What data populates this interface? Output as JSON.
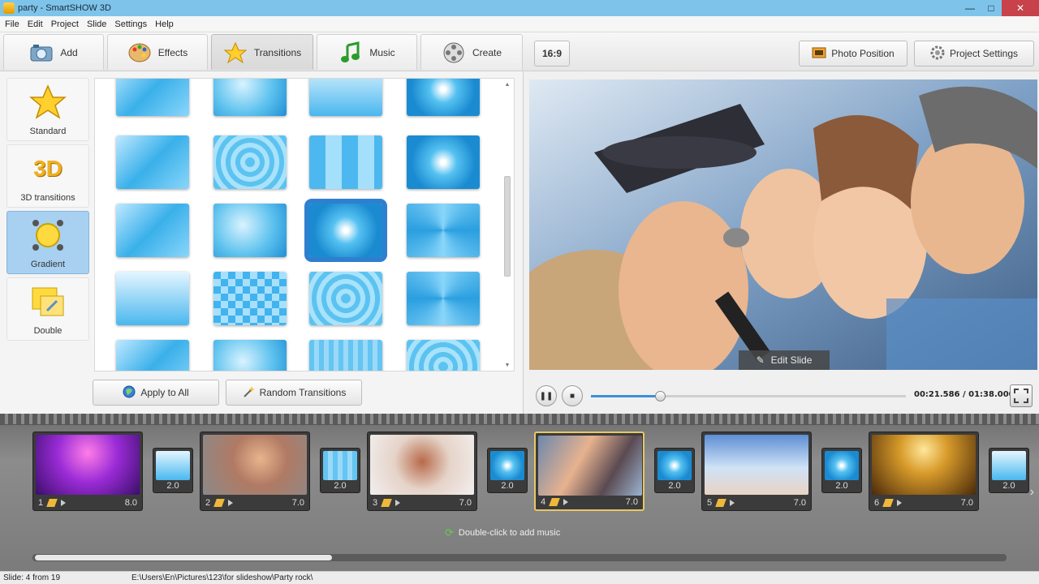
{
  "window": {
    "title": "party - SmartSHOW 3D"
  },
  "menu": [
    "File",
    "Edit",
    "Project",
    "Slide",
    "Settings",
    "Help"
  ],
  "toolbar": {
    "tabs": [
      {
        "label": "Add",
        "icon": "camera-icon"
      },
      {
        "label": "Effects",
        "icon": "palette-icon"
      },
      {
        "label": "Transitions",
        "icon": "star-icon"
      },
      {
        "label": "Music",
        "icon": "music-note-icon"
      },
      {
        "label": "Create",
        "icon": "film-reel-icon"
      }
    ],
    "aspect_label": "16:9",
    "photo_position_label": "Photo Position",
    "project_settings_label": "Project Settings"
  },
  "categories": [
    {
      "label": "Standard"
    },
    {
      "label": "3D transitions",
      "badge": "3D"
    },
    {
      "label": "Gradient"
    },
    {
      "label": "Double"
    }
  ],
  "transitions_panel": {
    "apply_all_label": "Apply to All",
    "random_label": "Random Transitions"
  },
  "preview": {
    "edit_slide_label": "Edit Slide",
    "timecode": "00:21.586 / 01:38.000",
    "progress": 0.22
  },
  "timeline": {
    "slides": [
      {
        "num": "1",
        "duration": "8.0"
      },
      {
        "num": "2",
        "duration": "7.0"
      },
      {
        "num": "3",
        "duration": "7.0"
      },
      {
        "num": "4",
        "duration": "7.0"
      },
      {
        "num": "5",
        "duration": "7.0"
      },
      {
        "num": "6",
        "duration": "7.0"
      }
    ],
    "transitions": [
      "2.0",
      "2.0",
      "2.0",
      "2.0",
      "2.0",
      "2.0"
    ],
    "music_hint": "Double-click to add music"
  },
  "status": {
    "slide_info": "Slide: 4 from 19",
    "path": "E:\\Users\\En\\Pictures\\123\\for slideshow\\Party rock\\"
  }
}
